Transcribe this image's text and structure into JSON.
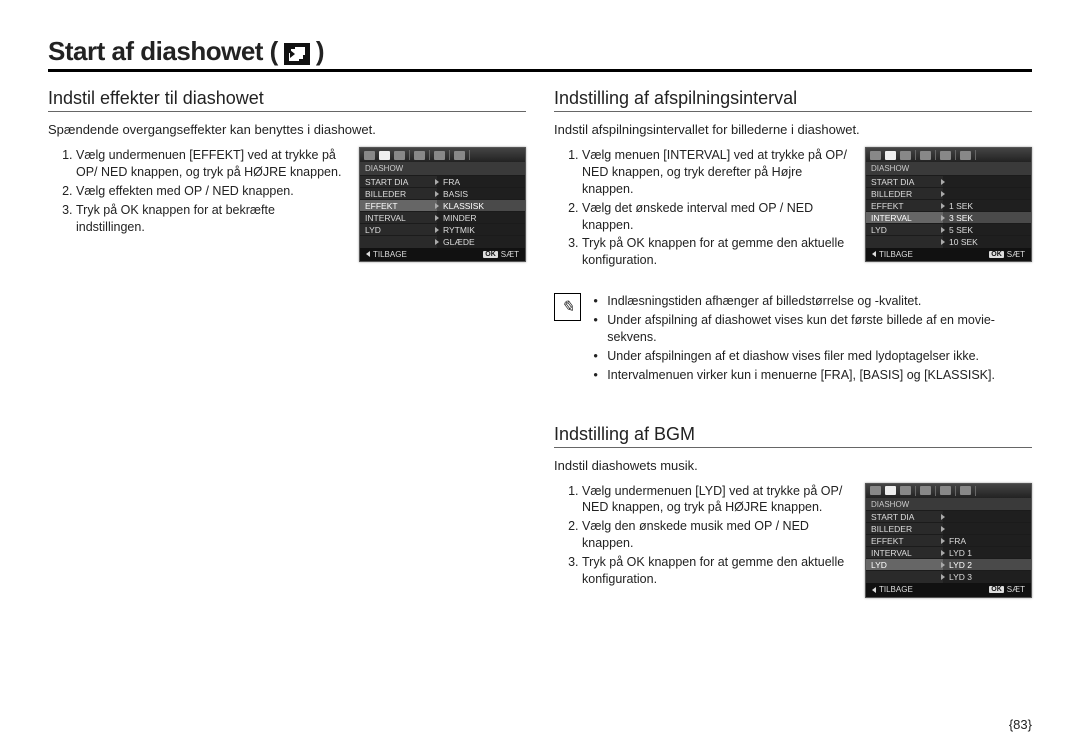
{
  "page_title_prefix": "Start af diashowet (",
  "page_title_suffix": ")",
  "page_number": "{83}",
  "left": {
    "heading": "Indstil effekter til diashowet",
    "intro": "Spændende overgangseffekter kan benyttes i diashowet.",
    "steps": [
      "Vælg undermenuen [EFFEKT] ved at trykke på OP/ NED knappen, og tryk på HØJRE knappen.",
      "Vælg effekten med OP / NED knappen.",
      "Tryk på OK knappen for at bekræfte indstillingen."
    ],
    "lcd": {
      "label": "DIASHOW",
      "rows": [
        {
          "l": "START DIA",
          "r": "FRA",
          "sel": false
        },
        {
          "l": "BILLEDER",
          "r": "BASIS",
          "sel": false
        },
        {
          "l": "EFFEKT",
          "r": "KLASSISK",
          "sel": true
        },
        {
          "l": "INTERVAL",
          "r": "MINDER",
          "sel": false
        },
        {
          "l": "LYD",
          "r": "RYTMIK",
          "sel": false
        },
        {
          "l": "",
          "r": "GLÆDE",
          "sel": false
        }
      ],
      "foot_left": "TILBAGE",
      "foot_ok": "OK",
      "foot_right": "SÆT"
    }
  },
  "right_top": {
    "heading": "Indstilling af afspilningsinterval",
    "intro": "Indstil afspilningsintervallet for billederne i diashowet.",
    "steps": [
      "Vælg menuen [INTERVAL] ved at trykke på OP/ NED knappen, og tryk derefter på Højre knappen.",
      "Vælg det ønskede interval med OP / NED knappen.",
      "Tryk på OK knappen for at gemme den aktuelle konfiguration."
    ],
    "lcd": {
      "label": "DIASHOW",
      "rows": [
        {
          "l": "START DIA",
          "r": "",
          "sel": false
        },
        {
          "l": "BILLEDER",
          "r": "",
          "sel": false
        },
        {
          "l": "EFFEKT",
          "r": "1 SEK",
          "sel": false
        },
        {
          "l": "INTERVAL",
          "r": "3 SEK",
          "sel": true
        },
        {
          "l": "LYD",
          "r": "5 SEK",
          "sel": false
        },
        {
          "l": "",
          "r": "10 SEK",
          "sel": false
        }
      ],
      "foot_left": "TILBAGE",
      "foot_ok": "OK",
      "foot_right": "SÆT"
    },
    "notes": [
      "Indlæsningstiden afhænger af billedstørrelse og -kvalitet.",
      "Under afspilning af diashowet vises kun det første billede af en movie-sekvens.",
      "Under afspilningen af et diashow vises filer med lydoptagelser ikke.",
      "Intervalmenuen virker kun i menuerne [FRA], [BASIS] og [KLASSISK]."
    ]
  },
  "right_bottom": {
    "heading": "Indstilling af BGM",
    "intro": "Indstil diashowets musik.",
    "steps": [
      "Vælg undermenuen [LYD] ved at trykke på OP/ NED knappen, og tryk på HØJRE knappen.",
      "Vælg den ønskede musik med OP / NED knappen.",
      "Tryk på OK knappen for at gemme den aktuelle konfiguration."
    ],
    "lcd": {
      "label": "DIASHOW",
      "rows": [
        {
          "l": "START DIA",
          "r": "",
          "sel": false
        },
        {
          "l": "BILLEDER",
          "r": "",
          "sel": false
        },
        {
          "l": "EFFEKT",
          "r": "FRA",
          "sel": false
        },
        {
          "l": "INTERVAL",
          "r": "LYD 1",
          "sel": false
        },
        {
          "l": "LYD",
          "r": "LYD 2",
          "sel": true
        },
        {
          "l": "",
          "r": "LYD 3",
          "sel": false
        }
      ],
      "foot_left": "TILBAGE",
      "foot_ok": "OK",
      "foot_right": "SÆT"
    }
  }
}
